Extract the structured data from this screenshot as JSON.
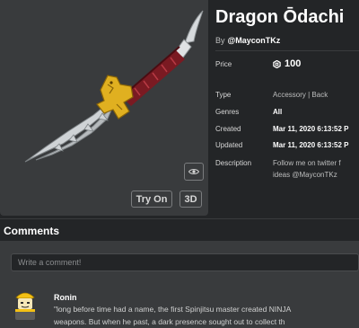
{
  "item": {
    "title": "Dragon Ōdachi",
    "creator_prefix": "By",
    "creator_name": "@MayconTKz"
  },
  "preview": {
    "eye_icon": "eye-icon",
    "try_on_label": "Try On",
    "three_d_label": "3D"
  },
  "details": {
    "price_label": "Price",
    "price_value": "100",
    "price_icon": "robux-icon",
    "type_label": "Type",
    "type_value": "Accessory | Back",
    "genres_label": "Genres",
    "genres_value": "All",
    "created_label": "Created",
    "created_value": "Mar 11, 2020 6:13:52 P",
    "updated_label": "Updated",
    "updated_value": "Mar 11, 2020 6:13:52 P",
    "description_label": "Description",
    "description_lines": [
      "Follow me on twitter f",
      "ideas @MayconTKz"
    ]
  },
  "comments": {
    "heading": "Comments",
    "input_placeholder": "Write a comment!",
    "items": [
      {
        "author": "Ronin",
        "lines": [
          "\"long before time had a name, the first Spinjitsu master created NINJA",
          "weapons. But when he past, a dark presence sought out to collect th"
        ]
      }
    ]
  },
  "colors": {
    "page_bg": "#232527",
    "panel_bg": "#393b3d",
    "text_primary": "#ffffff",
    "text_secondary": "#bdbebe",
    "blade": "#cfd3d6",
    "handle_red": "#7a1a22",
    "guard_gold": "#e0b020"
  }
}
